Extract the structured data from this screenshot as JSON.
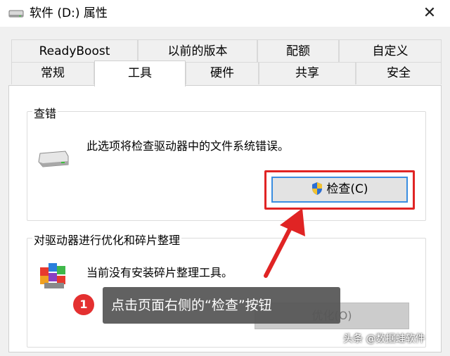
{
  "window": {
    "title": "软件 (D:) 属性",
    "close_label": "✕"
  },
  "tabs": {
    "row1": [
      "ReadyBoost",
      "以前的版本",
      "配额",
      "自定义"
    ],
    "row2": [
      "常规",
      "工具",
      "硬件",
      "共享",
      "安全"
    ],
    "active": "工具"
  },
  "check_group": {
    "title": "查错",
    "description": "此选项将检查驱动器中的文件系统错误。",
    "button_label": "检查(C)"
  },
  "optimize_group": {
    "title": "对驱动器进行优化和碎片整理",
    "description": "当前没有安装碎片整理工具。",
    "button_label": "优化(O)"
  },
  "annotation": {
    "step": "1",
    "text": "点击页面右侧的“检查”按钮",
    "highlight_color": "#e02424"
  },
  "watermark": "头条 @数据蛙软件"
}
